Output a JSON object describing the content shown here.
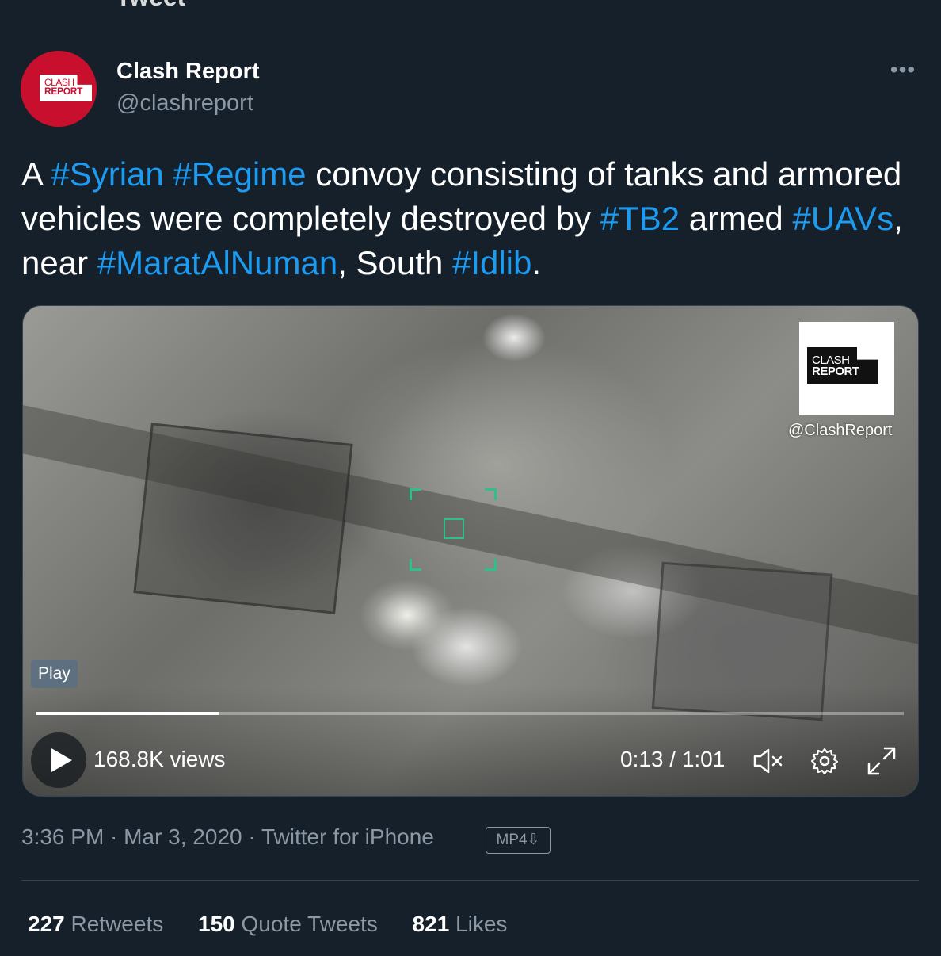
{
  "top_fragment": "Tweet",
  "author": {
    "display_name": "Clash Report",
    "handle": "@clashreport",
    "avatar_text_1": "CLASH",
    "avatar_text_2": "REPORT"
  },
  "more_label": "•••",
  "tweet": {
    "parts": [
      {
        "text": "A ",
        "tag": false
      },
      {
        "text": "#Syrian",
        "tag": true
      },
      {
        "text": " ",
        "tag": false
      },
      {
        "text": "#Regime",
        "tag": true
      },
      {
        "text": " convoy consisting of tanks and armored vehicles were completely destroyed by ",
        "tag": false
      },
      {
        "text": "#TB2",
        "tag": true
      },
      {
        "text": " armed ",
        "tag": false
      },
      {
        "text": "#UAVs",
        "tag": true
      },
      {
        "text": ", near ",
        "tag": false
      },
      {
        "text": "#MaratAlNuman",
        "tag": true
      },
      {
        "text": ", South ",
        "tag": false
      },
      {
        "text": "#Idlib",
        "tag": true
      },
      {
        "text": ".",
        "tag": false
      }
    ]
  },
  "video": {
    "watermark_line1": "CLASH",
    "watermark_line2": "REPORT",
    "watermark_handle": "@ClashReport",
    "play_label": "Play",
    "views": "168.8K views",
    "time": "0:13 / 1:01",
    "progress": 0.21
  },
  "meta": {
    "time": "3:36 PM",
    "date": "Mar 3, 2020",
    "source": "Twitter for iPhone",
    "separator": " · ",
    "badge": "MP4⇩"
  },
  "stats": {
    "retweets_count": "227",
    "retweets_label": "Retweets",
    "quotes_count": "150",
    "quotes_label": "Quote Tweets",
    "likes_count": "821",
    "likes_label": "Likes"
  },
  "colors": {
    "background": "#15202b",
    "hashtag": "#1d9bf0",
    "muted": "#8b98a5",
    "brand_red": "#c8102e"
  }
}
